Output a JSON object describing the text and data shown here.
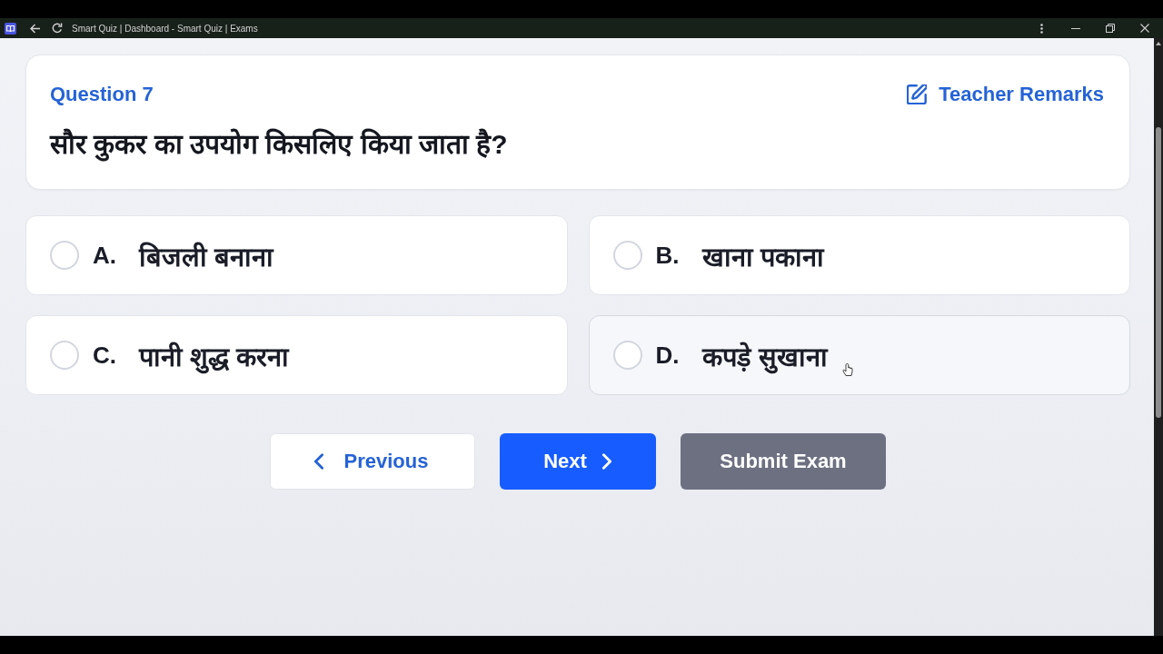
{
  "window": {
    "title": "Smart Quiz | Dashboard - Smart Quiz | Exams"
  },
  "question": {
    "label": "Question 7",
    "remarks_link": "Teacher Remarks",
    "text": "सौर कुकर का उपयोग किसलिए किया जाता है?"
  },
  "options": [
    {
      "letter": "A.",
      "text": "बिजली बनाना",
      "selected": false,
      "hovered": false
    },
    {
      "letter": "B.",
      "text": "खाना पकाना",
      "selected": false,
      "hovered": false
    },
    {
      "letter": "C.",
      "text": "पानी शुद्ध करना",
      "selected": false,
      "hovered": false
    },
    {
      "letter": "D.",
      "text": "कपड़े सुखाना",
      "selected": false,
      "hovered": true
    }
  ],
  "buttons": [
    {
      "kind": "previous",
      "label": "Previous"
    },
    {
      "kind": "next",
      "label": "Next"
    },
    {
      "kind": "submit",
      "label": "Submit Exam"
    }
  ]
}
